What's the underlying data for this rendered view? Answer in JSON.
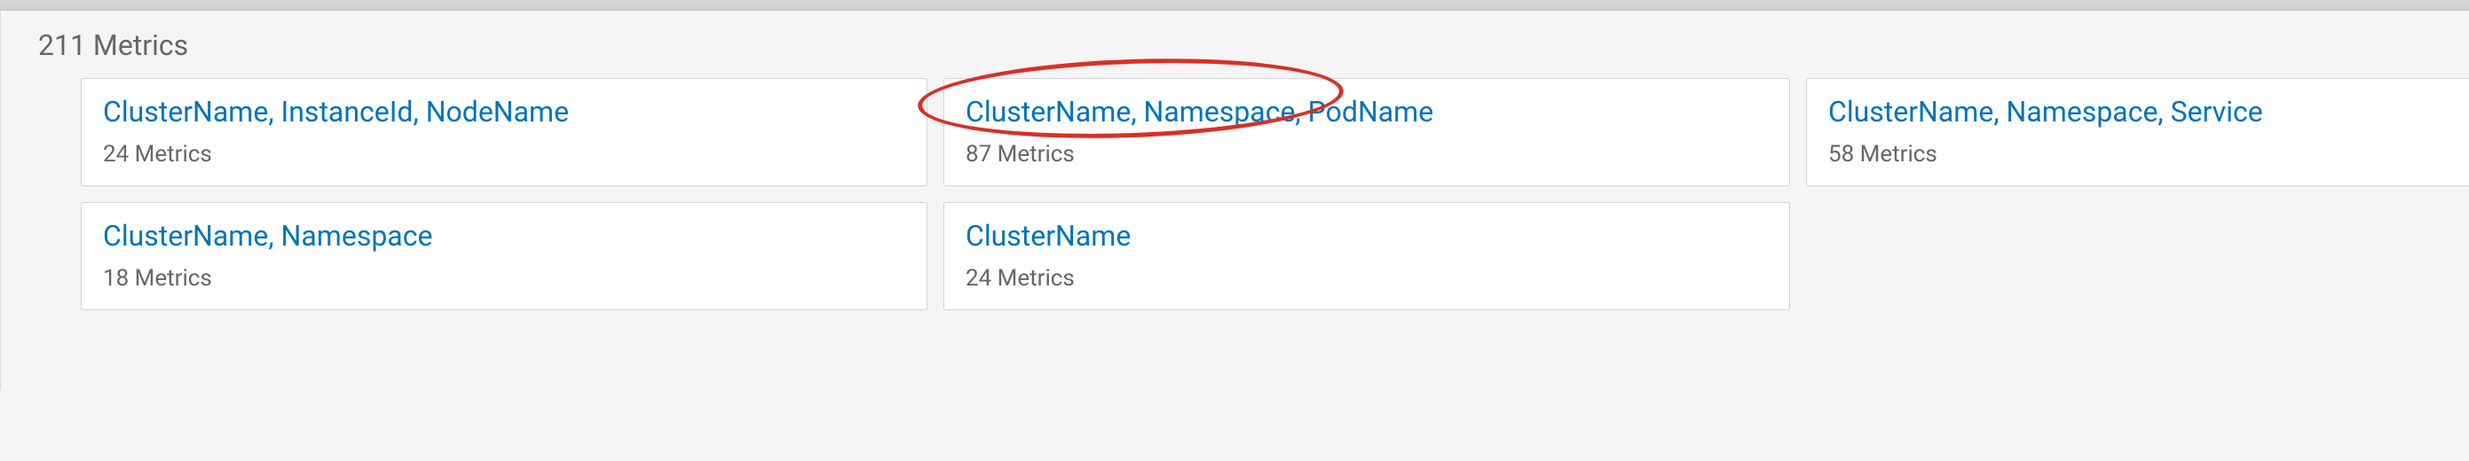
{
  "section_title": "211 Metrics",
  "cards": [
    {
      "title": "ClusterName, InstanceId, NodeName",
      "sub": "24 Metrics"
    },
    {
      "title": "ClusterName, Namespace, PodName",
      "sub": "87 Metrics",
      "highlighted": true
    },
    {
      "title": "ClusterName, Namespace, Service",
      "sub": "58 Metrics"
    },
    {
      "title": "ClusterName, Namespace",
      "sub": "18 Metrics"
    },
    {
      "title": "ClusterName",
      "sub": "24 Metrics"
    }
  ]
}
